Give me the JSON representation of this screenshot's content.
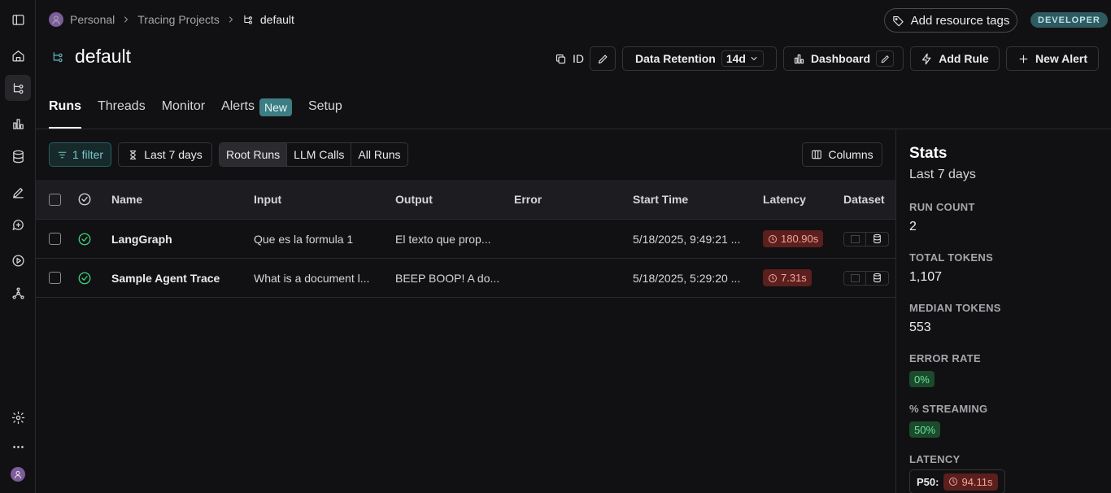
{
  "breadcrumb": {
    "workspace": "Personal",
    "section": "Tracing Projects",
    "project": "default"
  },
  "header": {
    "add_tags_label": "Add resource tags",
    "env_badge": "DEVELOPER",
    "title": "default",
    "id_label": "ID",
    "retention_label": "Data Retention",
    "retention_value": "14d",
    "dashboard_label": "Dashboard",
    "add_rule_label": "Add Rule",
    "new_alert_label": "New Alert"
  },
  "tabs": [
    {
      "label": "Runs"
    },
    {
      "label": "Threads"
    },
    {
      "label": "Monitor"
    },
    {
      "label": "Alerts",
      "badge": "New"
    },
    {
      "label": "Setup"
    }
  ],
  "toolbar": {
    "filter_label": "1 filter",
    "range_label": "Last 7 days",
    "segments": [
      "Root Runs",
      "LLM Calls",
      "All Runs"
    ],
    "columns_label": "Columns"
  },
  "table": {
    "columns": [
      "Name",
      "Input",
      "Output",
      "Error",
      "Start Time",
      "Latency",
      "Dataset"
    ],
    "rows": [
      {
        "name": "LangGraph",
        "input": "Que es la formula 1",
        "output": "El texto que prop...",
        "error": "",
        "start_time": "5/18/2025, 9:49:21 ...",
        "latency": "180.90s"
      },
      {
        "name": "Sample Agent Trace",
        "input": "What is a document l...",
        "output": "BEEP BOOP! A do...",
        "error": "",
        "start_time": "5/18/2025, 5:29:20 ...",
        "latency": "7.31s"
      }
    ]
  },
  "stats": {
    "title": "Stats",
    "range": "Last 7 days",
    "run_count_label": "RUN COUNT",
    "run_count": "2",
    "total_tokens_label": "TOTAL TOKENS",
    "total_tokens": "1,107",
    "median_tokens_label": "MEDIAN TOKENS",
    "median_tokens": "553",
    "error_rate_label": "ERROR RATE",
    "error_rate": "0%",
    "streaming_label": "% STREAMING",
    "streaming": "50%",
    "latency_label": "LATENCY",
    "p50_label": "P50:",
    "p50_value": "94.11s"
  },
  "colors": {
    "accent_teal": "#5fb6bd",
    "success_green": "#3fcf7a",
    "latency_red": "#5b1f1d"
  },
  "icons": {
    "rail": [
      "sidebar-toggle-icon",
      "home-icon",
      "tracing-icon",
      "chart-icon",
      "database-icon",
      "pen-icon",
      "chat-icon",
      "play-icon",
      "deploy-icon",
      "gear-icon",
      "more-icon",
      "user-avatar"
    ]
  }
}
